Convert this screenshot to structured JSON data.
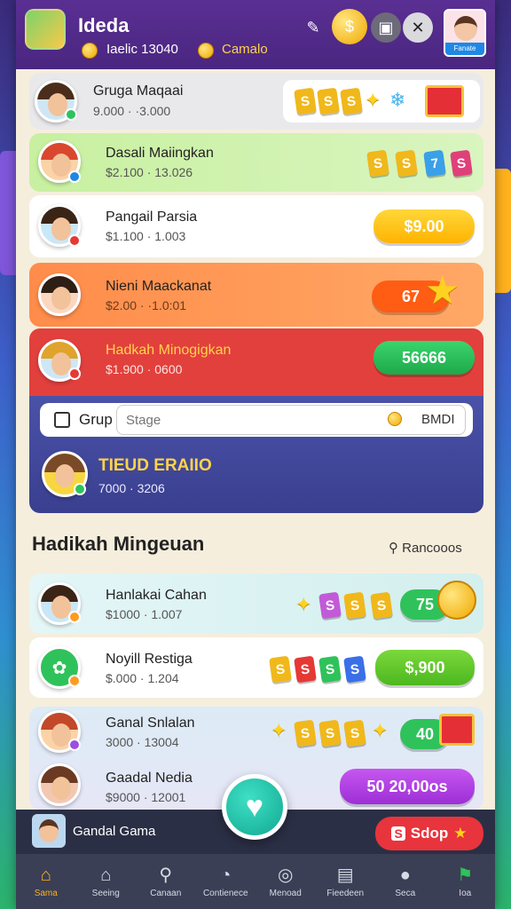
{
  "header": {
    "title": "Ideda",
    "subtitle_left": "Iaelic 13040",
    "subtitle_right": "Camalo",
    "avatar_label": "Fanate"
  },
  "rows": [
    {
      "name": "Gruga Maqaai",
      "sub": "9.000 · ·3.000",
      "bg": "#e9e9ec"
    },
    {
      "name": "Dasali Maiingkan",
      "sub": "$2.100 · 13.026",
      "bg": "#c6ee9a"
    },
    {
      "name": "Pangail Parsia",
      "sub": "$1.100 · 1.003",
      "pill": "$9.00",
      "bg": "#ffffff"
    },
    {
      "name": "Nieni Maackanat",
      "sub": "$2.00 · ·1.0:01",
      "pill": "67",
      "bg": "#ff9f5a"
    },
    {
      "name": "Hadkah Minogigkan",
      "sub": "$1.900 · 0600",
      "pill": "56666",
      "bg": "#e8403f"
    }
  ],
  "group": {
    "checkbox_label": "Grup",
    "input_placeholder": "Stage",
    "input_value": "BMDI",
    "title": "TIEUD ERAIIO",
    "sub": "7000 · 3206"
  },
  "section": {
    "title": "Hadikah Mingeuan",
    "search": "Rancooos"
  },
  "list": [
    {
      "name": "Hanlakai Cahan",
      "sub": "$1000 · 1.007",
      "pill": "75"
    },
    {
      "name": "Noyill Restiga",
      "sub": "$.000 · 1.204",
      "pill": "$,900"
    },
    {
      "name": "Ganal Snlalan",
      "sub": "3000 · 13004",
      "pill": "40"
    },
    {
      "name": "Gaadal Nedia",
      "sub": "$9000 · 12001",
      "pill": "50 20,00os"
    }
  ],
  "bottom": {
    "name": "Gandal Gama",
    "shop_label": "Sdop"
  },
  "nav": [
    {
      "label": "Sama",
      "icon": "home-icon",
      "glyph": "⌂"
    },
    {
      "label": "Seeing",
      "icon": "shop-icon",
      "glyph": "⌂"
    },
    {
      "label": "Canaan",
      "icon": "search-icon",
      "glyph": "⚲"
    },
    {
      "label": "Contienece",
      "icon": "clock-icon",
      "glyph": "◔"
    },
    {
      "label": "Menoad",
      "icon": "chat-icon",
      "glyph": "◎"
    },
    {
      "label": "Fieedeen",
      "icon": "chart-icon",
      "glyph": "▤"
    },
    {
      "label": "Seca",
      "icon": "user-icon",
      "glyph": "●"
    },
    {
      "label": "Ioa",
      "icon": "flag-icon",
      "glyph": "⚑"
    }
  ],
  "colors": {
    "header": "#4a2680",
    "green_pill": "#2fc25b",
    "yellow_pill": "#ffc21a",
    "orange_pill": "#ff6a1f",
    "purple_pill": "#b53ce6",
    "fab": "#1ec7a8"
  }
}
